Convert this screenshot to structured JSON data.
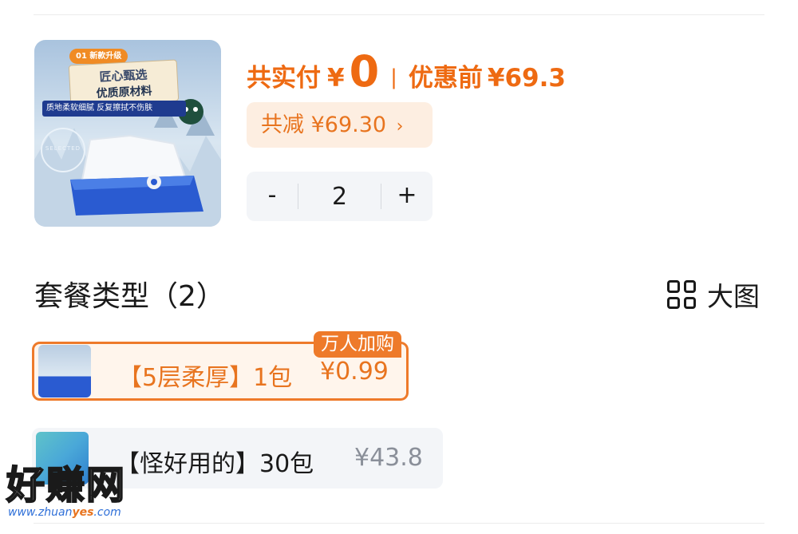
{
  "product": {
    "image_tag": "01 新款升级",
    "image_card_title": "匠心甄选",
    "image_card_subtitle": "优质原材料",
    "image_banner": "质地柔软细腻  反复擦拭不伤肤",
    "image_badge": "SELECTED"
  },
  "pricing": {
    "total_paid_label": "共实付",
    "currency": "¥",
    "total_paid_amount": "0",
    "separator": "|",
    "original_label": "优惠前",
    "original_amount": "¥69.3",
    "discount_text": "共减 ¥69.30",
    "discount_chevron": "›"
  },
  "quantity": {
    "minus": "-",
    "value": "2",
    "plus": "+"
  },
  "packages": {
    "title": "套餐类型（2）",
    "view_toggle_label": "大图",
    "options": [
      {
        "name": "【5层柔厚】1包",
        "price": "¥0.99",
        "badge": "万人加购",
        "selected": true
      },
      {
        "name": "【怪好用的】30包",
        "price": "¥43.8",
        "selected": false
      }
    ]
  },
  "watermark": {
    "title": "好赚网",
    "url_prefix": "www.zhuan",
    "url_highlight": "yes",
    "url_suffix": ".com"
  },
  "colors": {
    "accent": "#ee6a12",
    "accent_light": "#fdeee1",
    "stepper_bg": "#f3f5f8"
  }
}
